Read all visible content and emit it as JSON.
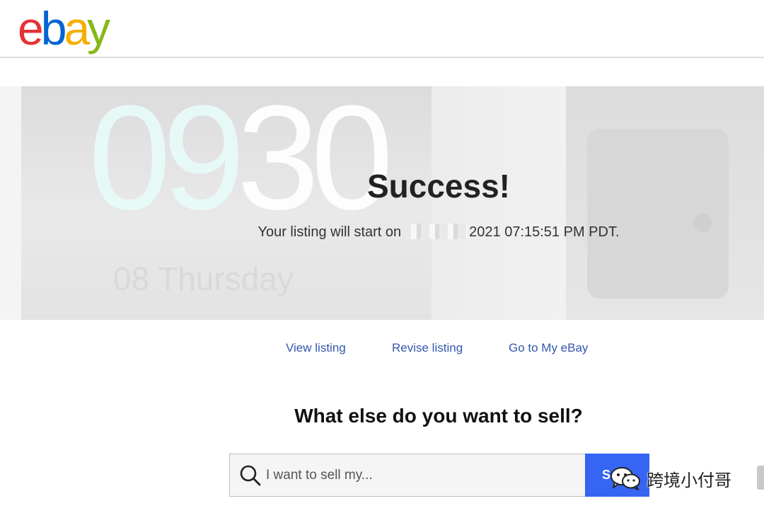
{
  "header": {
    "logo_letters": [
      "e",
      "b",
      "a",
      "y"
    ],
    "logo_colors": [
      "#e53238",
      "#0064d2",
      "#f5af02",
      "#86b817"
    ]
  },
  "hero": {
    "clock_text": "09",
    "clock_text_2": "30",
    "day_text": "08 Thursday",
    "title": "Success!",
    "listing_prefix": "Your listing will start on",
    "listing_suffix": "2021 07:15:51 PM PDT."
  },
  "links": {
    "view": "View listing",
    "revise": "Revise listing",
    "my_ebay": "Go to My eBay",
    "color": "#3457ad"
  },
  "sell": {
    "title": "What else do you want to sell?",
    "placeholder": "I want to sell my...",
    "button_label": "Sell",
    "button_color": "#3665f3"
  },
  "watermark": {
    "text": "跨境小付哥",
    "icon": "wechat-icon"
  }
}
